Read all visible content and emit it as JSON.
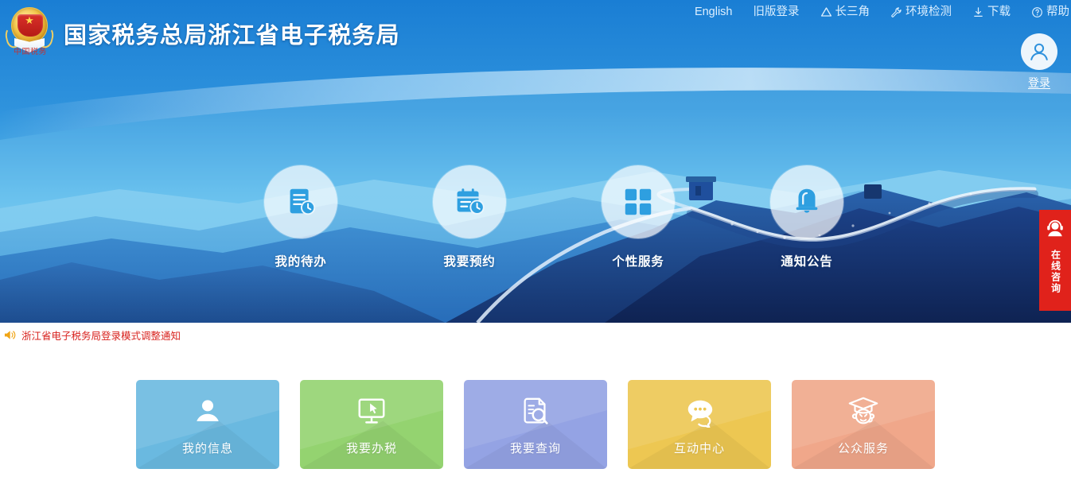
{
  "brand": {
    "title": "国家税务总局浙江省电子税务局",
    "emblem_caption": "中国税务",
    "emblem_icon": "china-tax-emblem-icon"
  },
  "topnav": {
    "items": [
      {
        "label": "English",
        "icon": "none"
      },
      {
        "label": "旧版登录",
        "icon": "none"
      },
      {
        "label": "长三角",
        "icon": "triangle-icon"
      },
      {
        "label": "环境检测",
        "icon": "wrench-icon"
      },
      {
        "label": "下载",
        "icon": "download-icon"
      },
      {
        "label": "帮助",
        "icon": "question-circle-icon"
      }
    ]
  },
  "login": {
    "label": "登录",
    "icon": "user-avatar-icon"
  },
  "banner": {
    "quick_links": [
      {
        "label": "我的待办",
        "icon": "document-clock-icon"
      },
      {
        "label": "我要预约",
        "icon": "calendar-clock-icon"
      },
      {
        "label": "个性服务",
        "icon": "grid-squares-icon"
      },
      {
        "label": "通知公告",
        "icon": "bell-icon"
      }
    ]
  },
  "notice": {
    "icon": "speaker-horn-icon",
    "text": "浙江省电子税务局登录模式调整通知",
    "color": "#d8231f"
  },
  "cards": [
    {
      "label": "我的信息",
      "icon": "person-icon",
      "color": "#6ab9e0"
    },
    {
      "label": "我要办税",
      "icon": "monitor-cursor-icon",
      "color": "#94d370"
    },
    {
      "label": "我要查询",
      "icon": "document-search-icon",
      "color": "#94a3e4"
    },
    {
      "label": "互动中心",
      "icon": "chat-bubbles-icon",
      "color": "#edc752"
    },
    {
      "label": "公众服务",
      "icon": "graduate-headset-icon",
      "color": "#f0a78a"
    }
  ],
  "consult": {
    "label": "在线咨询",
    "icon": "headset-person-icon",
    "color": "#e0221b"
  },
  "theme": {
    "header_blue": "#1a7ed4",
    "sky_light": "#6ec4ef",
    "wall_dark": "#143b7a"
  }
}
